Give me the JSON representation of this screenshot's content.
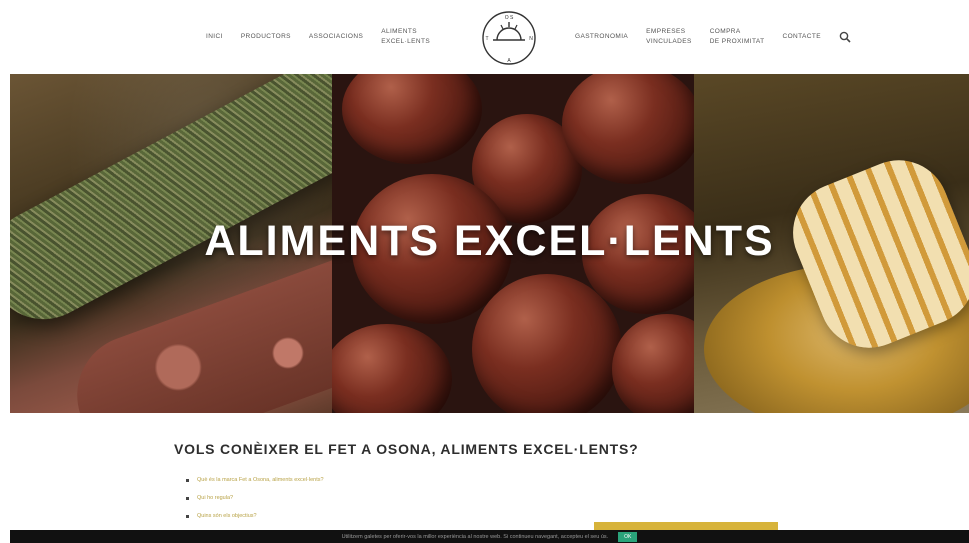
{
  "nav": {
    "left": [
      {
        "label": "Inici"
      },
      {
        "label": "Productors"
      },
      {
        "label": "Associacions"
      },
      {
        "label_lines": [
          "Aliments",
          "excel·lents"
        ]
      }
    ],
    "right": [
      {
        "label": "Gastronomia"
      },
      {
        "label_lines": [
          "Empreses",
          "vinculades"
        ]
      },
      {
        "label_lines": [
          "Compra",
          "de proximitat"
        ]
      },
      {
        "label": "Contacte"
      }
    ],
    "search_icon": "search-icon",
    "logo_text": "FET A OSONA"
  },
  "hero": {
    "title": "ALIMENTS EXCEL·LENTS"
  },
  "content": {
    "title": "VOLS CONÈIXER EL FET A OSONA, ALIMENTS EXCEL·LENTS?",
    "links": [
      "Què és la marca Fet a Osona, aliments excel·lents?",
      "Qui ho regula?",
      "Quins són els objectius?"
    ]
  },
  "cookie": {
    "text": "Utilitzem galetes per oferir-vos la millor experiència al nostre web. Si continueu navegant, accepteu el seu ús.",
    "accept": "OK"
  },
  "colors": {
    "accent_yellow": "#d7b33a",
    "link_color": "#b8a246",
    "cookie_bg": "#111111",
    "cookie_button": "#2aa37a"
  }
}
